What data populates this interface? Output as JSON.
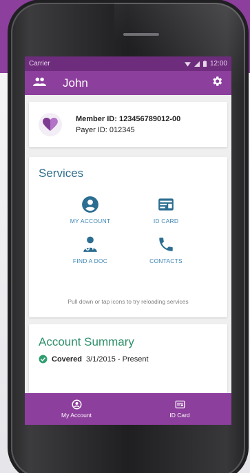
{
  "status_bar": {
    "carrier": "Carrier",
    "time": "12:00"
  },
  "app_bar": {
    "title": "John",
    "people_icon": "people-icon",
    "settings_icon": "gear-icon"
  },
  "member": {
    "member_id": "Member ID: 123456789012-00",
    "payer_id": "Payer ID: 012345"
  },
  "services": {
    "title": "Services",
    "items": [
      {
        "label": "MY ACCOUNT",
        "icon": "account-circle-icon"
      },
      {
        "label": "ID CARD",
        "icon": "id-card-icon"
      },
      {
        "label": "FIND A DOC",
        "icon": "doctor-icon"
      },
      {
        "label": "CONTACTS",
        "icon": "phone-icon"
      }
    ],
    "hint": "Pull down or tap icons to try reloading services"
  },
  "account_summary": {
    "title": "Account Summary",
    "status": "Covered",
    "date_range": "3/1/2015 - Present"
  },
  "bottom_nav": [
    {
      "label": "My Account",
      "icon": "account-circle-icon"
    },
    {
      "label": "ID Card",
      "icon": "id-card-icon"
    }
  ],
  "colors": {
    "brand_purple": "#8d3f9d",
    "status_purple": "#6e2c7d",
    "services_teal": "#2f6f8f",
    "summary_green": "#2f8f6a",
    "link_blue": "#3d86b5"
  }
}
